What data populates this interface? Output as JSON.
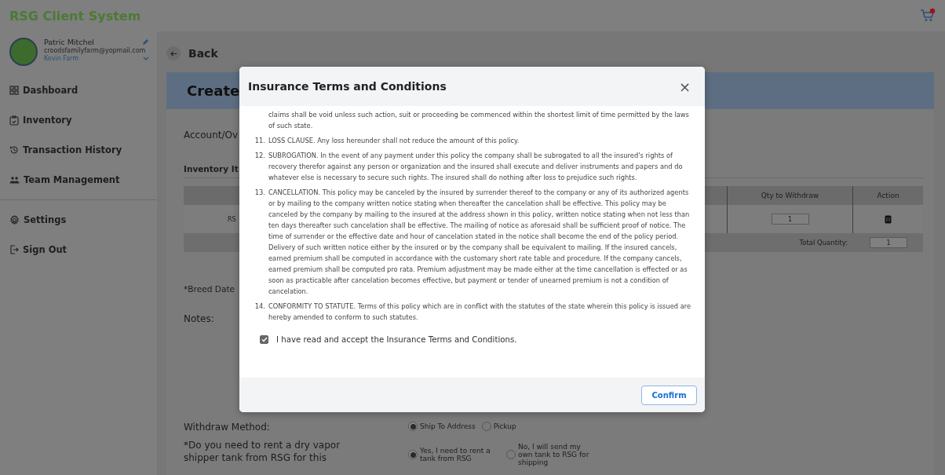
{
  "app": {
    "title": "RSG Client System",
    "cart_badge": true
  },
  "user": {
    "name": "Patric Mitchel",
    "email": "croodsfamilyfarm@yopmail.com",
    "farm": "Kevin Farm"
  },
  "sidebar": {
    "items": [
      {
        "label": "Dashboard",
        "selected": false
      },
      {
        "label": "Inventory",
        "selected": false
      },
      {
        "label": "Transaction History",
        "selected": false
      },
      {
        "label": "Team Management",
        "selected": false
      }
    ],
    "bottom_items": [
      {
        "label": "Settings"
      },
      {
        "label": "Sign Out"
      }
    ]
  },
  "page": {
    "back": "Back",
    "title": "Create",
    "account_label": "Account/Ov",
    "section_title": "Inventory It",
    "table": {
      "columns": [
        {},
        {
          "label": "Qty to Withdraw"
        },
        {
          "label": "Action"
        }
      ],
      "rows": [
        {
          "column_1": "RS",
          "qty": "1"
        }
      ],
      "total_label": "Total Quantity:",
      "total_value": "1"
    },
    "breed_label": "*Breed Date",
    "notes_label": "Notes:",
    "withdraw": {
      "label": "Withdraw Method:",
      "options": [
        {
          "label": "Ship To Address",
          "selected": true
        },
        {
          "label": "Pickup",
          "selected": false
        }
      ]
    },
    "tank": {
      "label": "*Do you need to rent a dry vapor shipper tank from RSG for this",
      "options": [
        {
          "label": "Yes, I need to rent a tank from RSG",
          "selected": true
        },
        {
          "label": "No, I will send my own tank to RSG for shipping",
          "selected": false
        }
      ]
    }
  },
  "modal": {
    "title": "Insurance Terms and Conditions",
    "close": "×",
    "terms": [
      {
        "text": "claims shall be void unless such action, suit or proceeding be commenced within the shortest limit of time permitted by the laws of such state."
      },
      {
        "number": "11.",
        "text": "LOSS CLAUSE. Any loss hereunder shall not reduce the amount of this policy."
      },
      {
        "number": "12.",
        "text": "SUBROGATION. In the event of any payment under this policy the company shall be subrogated to all the insured's rights of recovery therefor against any person or organization and the insured shall execute and deliver instruments and papers and do whatever else is necessary to secure such rights. The insured shall do nothing after loss to prejudice such rights."
      },
      {
        "number": "13.",
        "text": "CANCELLATION. This policy may be canceled by the insured by surrender thereof to the company or any of its authorized agents or by mailing to the company written notice stating when thereafter the cancelation shall be effective. This policy may be canceled by the company by mailing to the insured at the address shown in this policy, written notice stating when not less than ten days thereafter such cancelation shall be effective. The mailing of notice as aforesaid shall be sufficient proof of notice. The time of surrender or the effective date and hour of cancelation stated in the notice shall become the end of the policy period. Delivery of such written notice either by the insured or by the company shall be equivalent to mailing. If the insured cancels, earned premium shall be computed in accordance with the customary short rate table and procedure. If the company cancels, earned premium shall be computed pro rata. Premium adjustment may be made either at the time cancellation is effected or as soon as practicable after cancelation becomes effective, but payment or tender of unearned premium is not a condition of cancelation."
      },
      {
        "number": "14.",
        "text": "CONFORMITY TO STATUTE. Terms of this policy which are in conflict with the statutes of the state wherein this policy is issued are hereby amended to conform to such statutes."
      }
    ],
    "accept": {
      "label": "I have read and accept the Insurance Terms and Conditions.",
      "checked": true
    },
    "confirm": "Confirm"
  }
}
